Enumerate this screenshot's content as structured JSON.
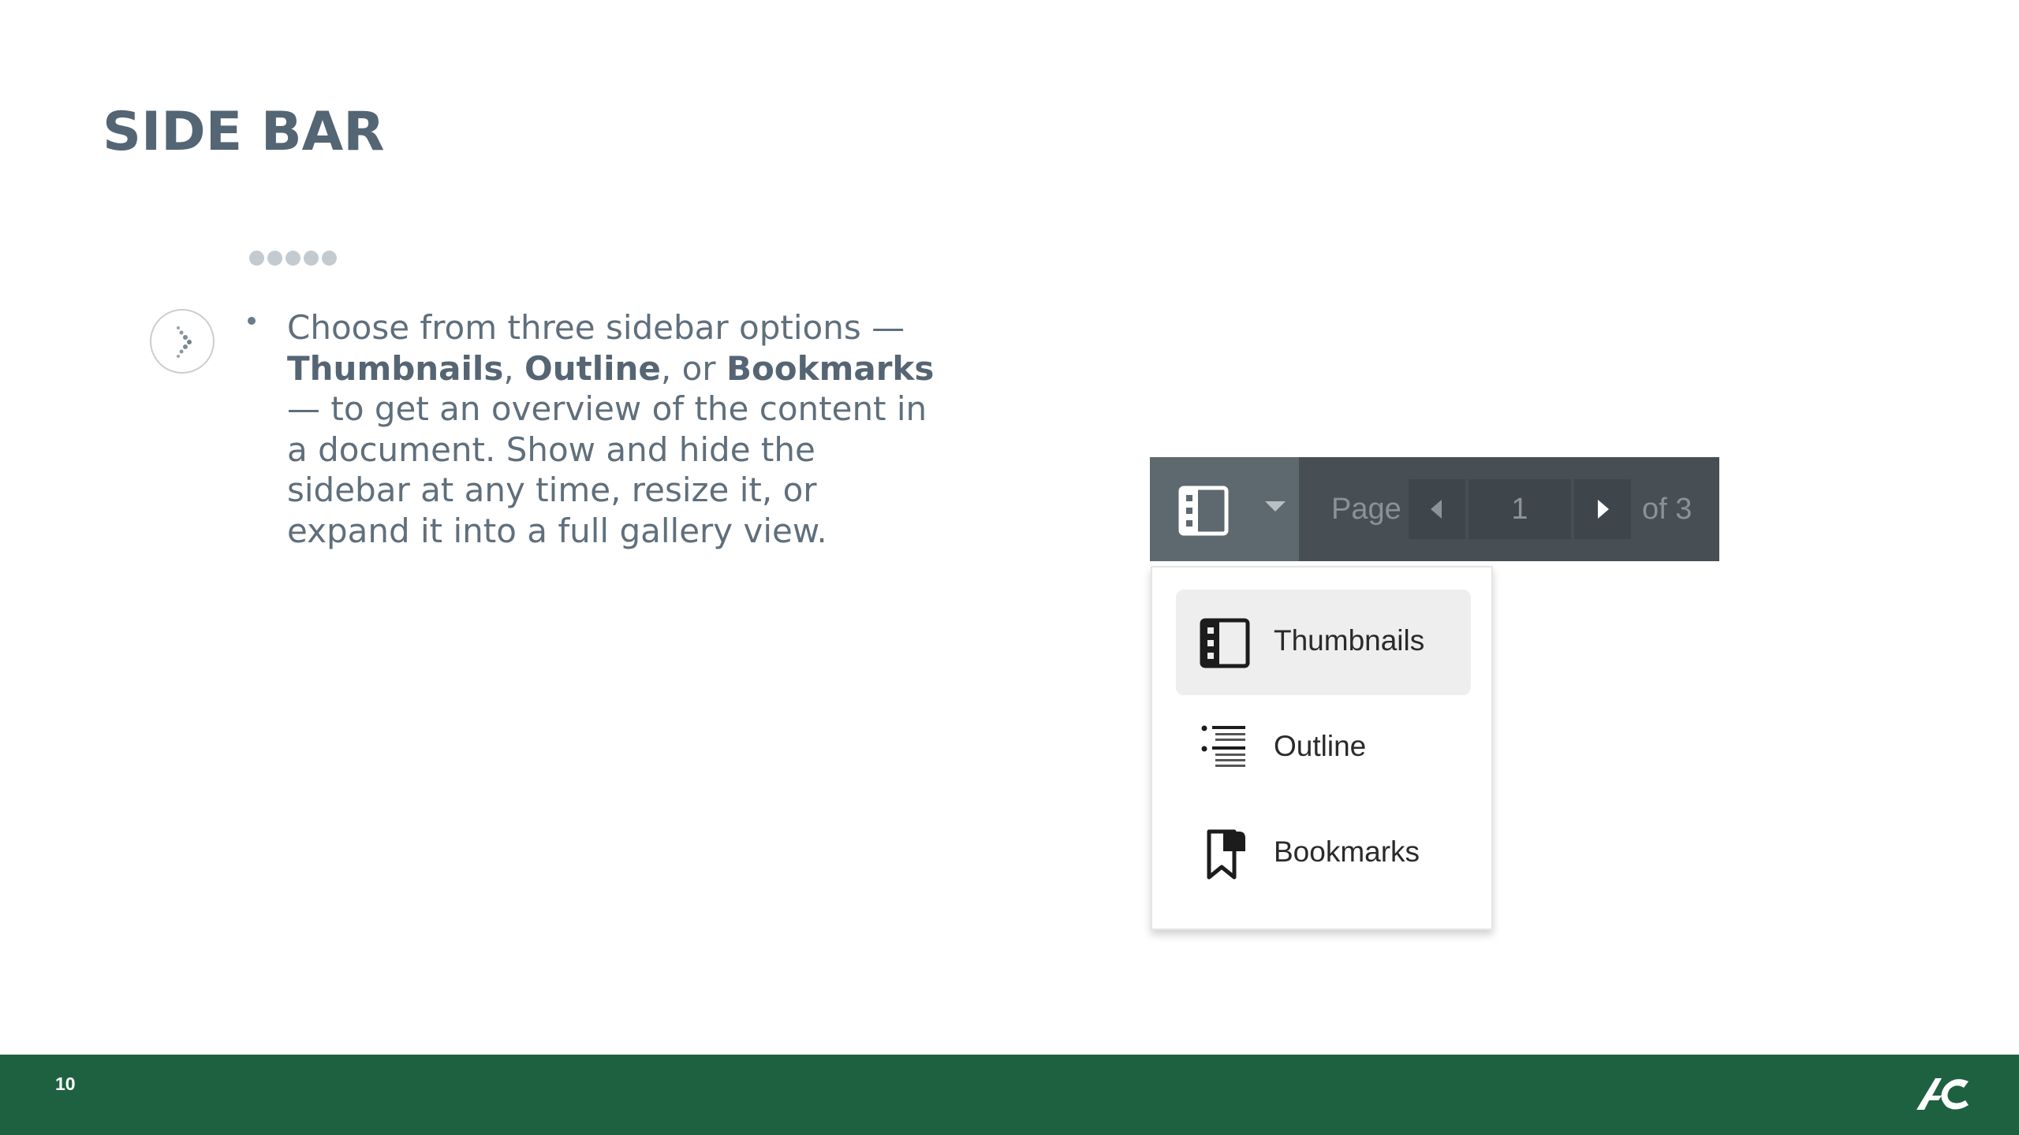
{
  "slide": {
    "title": "SIDE BAR",
    "page_number": "10",
    "body": {
      "intro": "Choose from three sidebar options —",
      "option1": "Thumbnails",
      "sep1": ",",
      "option2": "Outline",
      "sep2": ", or",
      "option3": "Bookmarks",
      "rest": "— to get an overview of the content in a document. Show and hide the sidebar at any time, resize it, or expand it into a full gallery view."
    }
  },
  "toolbar": {
    "page_label": "Page",
    "page_value": "1",
    "page_total": "of 3"
  },
  "sidebar_menu": {
    "items": [
      {
        "label": "Thumbnails",
        "icon": "thumbnails-icon",
        "selected": true
      },
      {
        "label": "Outline",
        "icon": "outline-icon",
        "selected": false
      },
      {
        "label": "Bookmarks",
        "icon": "bookmark-icon",
        "selected": false
      }
    ]
  },
  "colors": {
    "title": "#546574",
    "footer": "#1e6141",
    "toolbar": "#474f55",
    "toolbar_toggle": "#5e686f",
    "menu_selected": "#eeeeee"
  }
}
